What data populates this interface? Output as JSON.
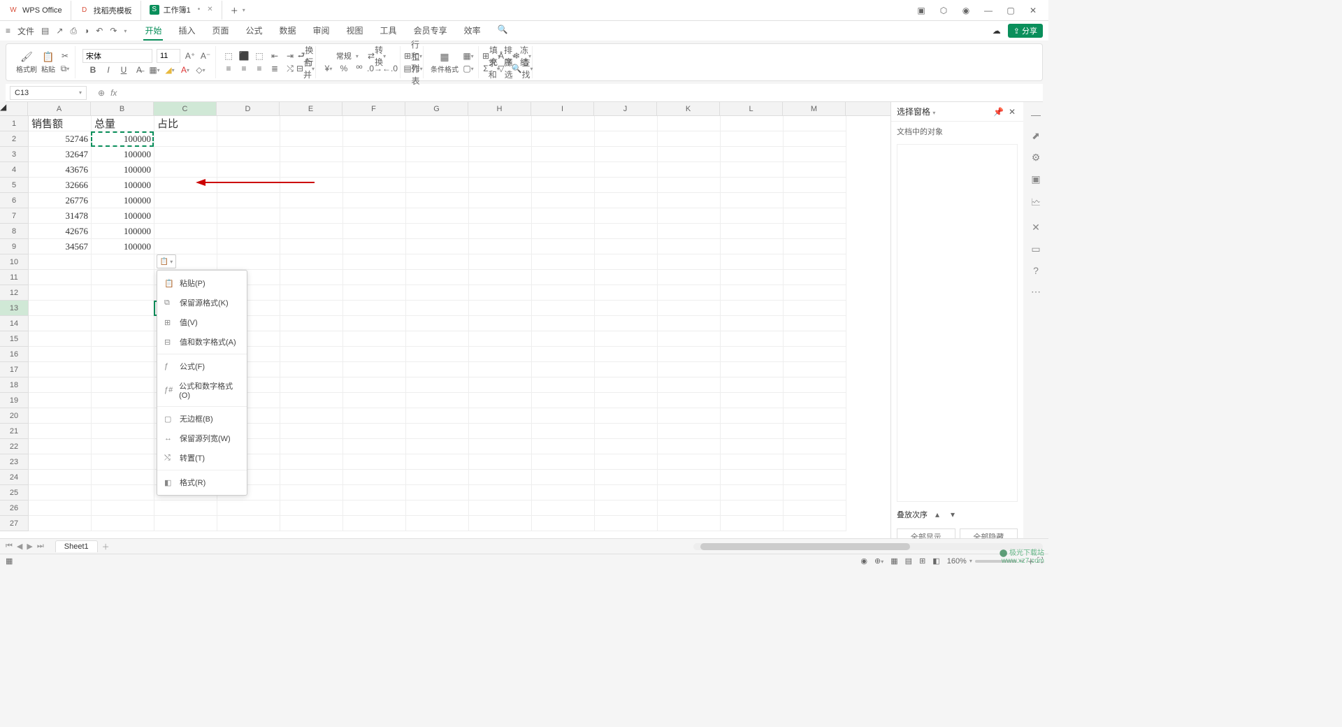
{
  "tabs": {
    "app": "WPS Office",
    "template": "找稻壳模板",
    "workbook": "工作簿1"
  },
  "file_menu": "文件",
  "menus": {
    "start": "开始",
    "insert": "插入",
    "page": "页面",
    "formula": "公式",
    "data": "数据",
    "review": "审阅",
    "view": "视图",
    "tools": "工具",
    "member": "会员专享",
    "efficiency": "效率"
  },
  "share": "分享",
  "ribbon": {
    "format_painter": "格式刷",
    "paste": "粘贴",
    "font": "宋体",
    "size": "11",
    "general": "常规",
    "convert": "转换",
    "row_col": "行和列",
    "worksheet": "工作表",
    "cond_fmt": "条件格式",
    "fill": "填充",
    "sort": "排序",
    "freeze": "冻结",
    "sum": "求和",
    "filter": "筛选",
    "find": "查找",
    "wrap": "换行",
    "merge": "合并"
  },
  "name_box": "C13",
  "columns": [
    "A",
    "B",
    "C",
    "D",
    "E",
    "F",
    "G",
    "H",
    "I",
    "J",
    "K",
    "L",
    "M"
  ],
  "rows": [
    "1",
    "2",
    "3",
    "4",
    "5",
    "6",
    "7",
    "8",
    "9",
    "10",
    "11",
    "12",
    "13",
    "14",
    "15",
    "16",
    "17",
    "18",
    "19",
    "20",
    "21",
    "22",
    "23",
    "24",
    "25",
    "26",
    "27"
  ],
  "headers": {
    "a": "销售额",
    "b": "总量",
    "c": "占比"
  },
  "data_a": [
    "52746",
    "32647",
    "43676",
    "32666",
    "26776",
    "31478",
    "42676",
    "34567"
  ],
  "data_b": [
    "100000",
    "100000",
    "100000",
    "100000",
    "100000",
    "100000",
    "100000",
    "100000"
  ],
  "paste_options": {
    "p": "粘贴(P)",
    "k": "保留源格式(K)",
    "v": "值(V)",
    "a": "值和数字格式(A)",
    "f": "公式(F)",
    "o": "公式和数字格式(O)",
    "b": "无边框(B)",
    "w": "保留源列宽(W)",
    "t": "转置(T)",
    "r": "格式(R)"
  },
  "side": {
    "title": "选择窗格",
    "subtitle": "文档中的对象",
    "stack": "叠放次序",
    "show_all": "全部显示",
    "hide_all": "全部隐藏"
  },
  "sheet": "Sheet1",
  "zoom": "160%",
  "watermark": {
    "l1": "极光下载站",
    "l2": "www.xz7.com"
  }
}
